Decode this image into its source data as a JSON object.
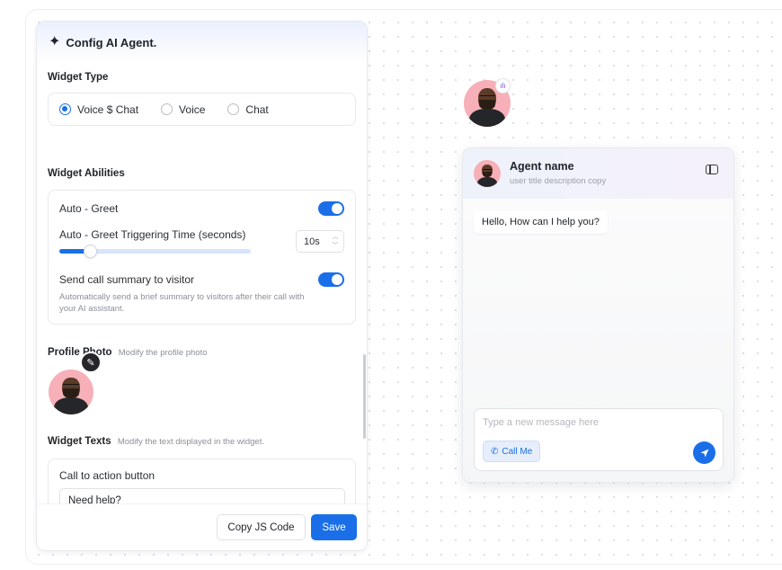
{
  "panel": {
    "title": "Config AI Agent.",
    "widget_type": {
      "label": "Widget Type",
      "options": [
        "Voice $ Chat",
        "Voice",
        "Chat"
      ],
      "selected": "Voice $ Chat"
    },
    "abilities": {
      "label": "Widget Abilities",
      "auto_greet": {
        "label": "Auto - Greet",
        "enabled": true
      },
      "trigger_time": {
        "label": "Auto - Greet Triggering Time (seconds)",
        "value": "10s",
        "slider_fraction": 0.16
      },
      "call_summary": {
        "label": "Send call summary to visitor",
        "description": "Automatically send a brief summary to visitors after their call with your AI assistant.",
        "enabled": true
      }
    },
    "profile_photo": {
      "label": "Profile Photo",
      "hint": "Modify the profile photo"
    },
    "widget_texts": {
      "label": "Widget Texts",
      "hint": "Modify the text displayed in the widget.",
      "cta": {
        "label": "Call to action button",
        "value": "Need help?"
      }
    },
    "footer": {
      "copy_label": "Copy JS Code",
      "save_label": "Save"
    }
  },
  "preview": {
    "agent_name": "Agent name",
    "agent_description": "user title description copy",
    "greeting": "Hello, How can I help you?",
    "composer_placeholder": "Type a new message here",
    "call_me_label": "Call Me"
  },
  "colors": {
    "accent": "#1a6fe8",
    "avatar_bg": "#f7b0b8"
  },
  "icons": [
    "sparkle-icon",
    "pencil-icon",
    "waveform-icon",
    "sidebar-toggle-icon",
    "phone-icon",
    "send-icon"
  ]
}
